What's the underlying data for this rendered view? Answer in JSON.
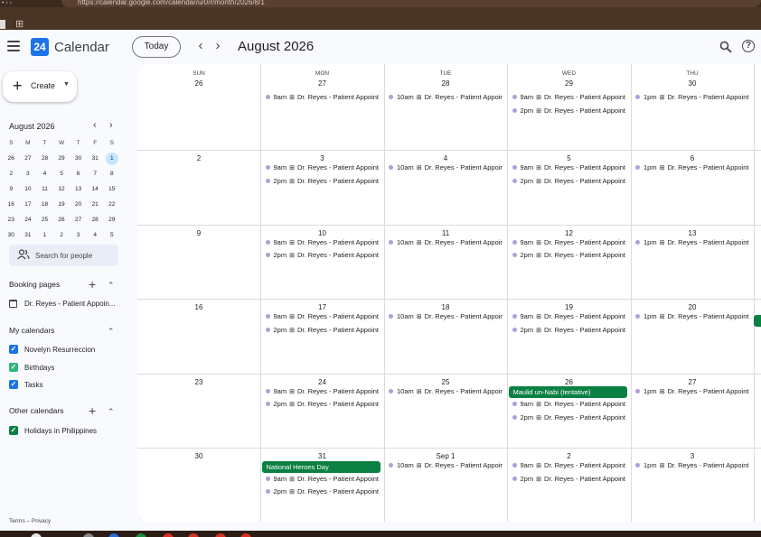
{
  "browser": {
    "url": "https://calendar.google.com/calendar/u/0/r/month/2026/8/1"
  },
  "header": {
    "app_title": "Calendar",
    "logo_day": "24",
    "today_label": "Today",
    "prev": "‹",
    "next": "›",
    "month_title": "August 2026",
    "help": "?"
  },
  "sidebar": {
    "create_label": "Create",
    "mini_month": "August 2026",
    "mini_days": [
      "S",
      "M",
      "T",
      "W",
      "T",
      "F",
      "S"
    ],
    "mini_weeks": [
      [
        "26",
        "27",
        "28",
        "29",
        "30",
        "31",
        "1"
      ],
      [
        "2",
        "3",
        "4",
        "5",
        "6",
        "7",
        "8"
      ],
      [
        "9",
        "10",
        "11",
        "12",
        "13",
        "14",
        "15"
      ],
      [
        "16",
        "17",
        "18",
        "19",
        "20",
        "21",
        "22"
      ],
      [
        "23",
        "24",
        "25",
        "26",
        "27",
        "28",
        "29"
      ],
      [
        "30",
        "31",
        "1",
        "2",
        "3",
        "4",
        "5"
      ]
    ],
    "search_people": "Search for people",
    "booking_title": "Booking pages",
    "booking_item": "Dr. Reyes - Patient Appoin...",
    "my_calendars_title": "My calendars",
    "my_calendars": [
      {
        "label": "Novelyn Resurreccion",
        "color": "#1a73e8"
      },
      {
        "label": "Birthdays",
        "color": "#33b679"
      },
      {
        "label": "Tasks",
        "color": "#1a73e8"
      }
    ],
    "other_calendars_title": "Other calendars",
    "other_calendars": [
      {
        "label": "Holidays in Philippines",
        "color": "#0b8043"
      }
    ],
    "footer": "Terms – Privacy"
  },
  "grid": {
    "dow": [
      "SUN",
      "MON",
      "TUE",
      "WED",
      "THU"
    ],
    "weeks": [
      {
        "days": [
          "26",
          "27",
          "28",
          "29",
          "30"
        ],
        "allday": [],
        "events": [
          [],
          [
            "9am",
            "Dr. Reyes - Patient Appoint"
          ],
          [
            "10am",
            "Dr. Reyes - Patient Appoir"
          ],
          [
            "9am",
            "Dr. Reyes - Patient Appoint",
            "2pm",
            "Dr. Reyes - Patient Appoint"
          ],
          [
            "1pm",
            "Dr. Reyes - Patient Appoint"
          ]
        ]
      },
      {
        "days": [
          "2",
          "3",
          "4",
          "5",
          "6"
        ],
        "allday": [],
        "events": [
          [],
          [
            "9am",
            "Dr. Reyes - Patient Appoint",
            "2pm",
            "Dr. Reyes - Patient Appoint"
          ],
          [
            "10am",
            "Dr. Reyes - Patient Appoir"
          ],
          [
            "9am",
            "Dr. Reyes - Patient Appoint",
            "2pm",
            "Dr. Reyes - Patient Appoint"
          ],
          [
            "1pm",
            "Dr. Reyes - Patient Appoint"
          ]
        ]
      },
      {
        "days": [
          "9",
          "10",
          "11",
          "12",
          "13"
        ],
        "allday": [],
        "events": [
          [],
          [
            "9am",
            "Dr. Reyes - Patient Appoint",
            "2pm",
            "Dr. Reyes - Patient Appoint"
          ],
          [
            "10am",
            "Dr. Reyes - Patient Appoir"
          ],
          [
            "9am",
            "Dr. Reyes - Patient Appoint",
            "2pm",
            "Dr. Reyes - Patient Appoint"
          ],
          [
            "1pm",
            "Dr. Reyes - Patient Appoint"
          ]
        ]
      },
      {
        "days": [
          "16",
          "17",
          "18",
          "19",
          "20"
        ],
        "allday": [],
        "events": [
          [],
          [
            "9am",
            "Dr. Reyes - Patient Appoint",
            "2pm",
            "Dr. Reyes - Patient Appoint"
          ],
          [
            "10am",
            "Dr. Reyes - Patient Appoir"
          ],
          [
            "9am",
            "Dr. Reyes - Patient Appoint",
            "2pm",
            "Dr. Reyes - Patient Appoint"
          ],
          [
            "1pm",
            "Dr. Reyes - Patient Appoint"
          ]
        ]
      },
      {
        "days": [
          "23",
          "24",
          "25",
          "26",
          "27"
        ],
        "allday": [
          {
            "col": 3,
            "label": "Maulid un-Nabi (tentative)"
          }
        ],
        "events": [
          [],
          [
            "9am",
            "Dr. Reyes - Patient Appoint",
            "2pm",
            "Dr. Reyes - Patient Appoint"
          ],
          [
            "10am",
            "Dr. Reyes - Patient Appoir"
          ],
          [
            "9am",
            "Dr. Reyes - Patient Appoint",
            "2pm",
            "Dr. Reyes - Patient Appoint"
          ],
          [
            "1pm",
            "Dr. Reyes - Patient Appoint"
          ]
        ]
      },
      {
        "days": [
          "30",
          "31",
          "Sep 1",
          "2",
          "3"
        ],
        "allday": [
          {
            "col": 1,
            "label": "National Heroes Day"
          }
        ],
        "events": [
          [],
          [
            "9am",
            "Dr. Reyes - Patient Appoint",
            "2pm",
            "Dr. Reyes - Patient Appoint"
          ],
          [
            "10am",
            "Dr. Reyes - Patient Appoir"
          ],
          [
            "9am",
            "Dr. Reyes - Patient Appoint",
            "2pm",
            "Dr. Reyes - Patient Appoint"
          ],
          [
            "1pm",
            "Dr. Reyes - Patient Appoint"
          ]
        ]
      }
    ],
    "event_dot_color": "#b39ddb",
    "allday_color": "#0b8043"
  }
}
